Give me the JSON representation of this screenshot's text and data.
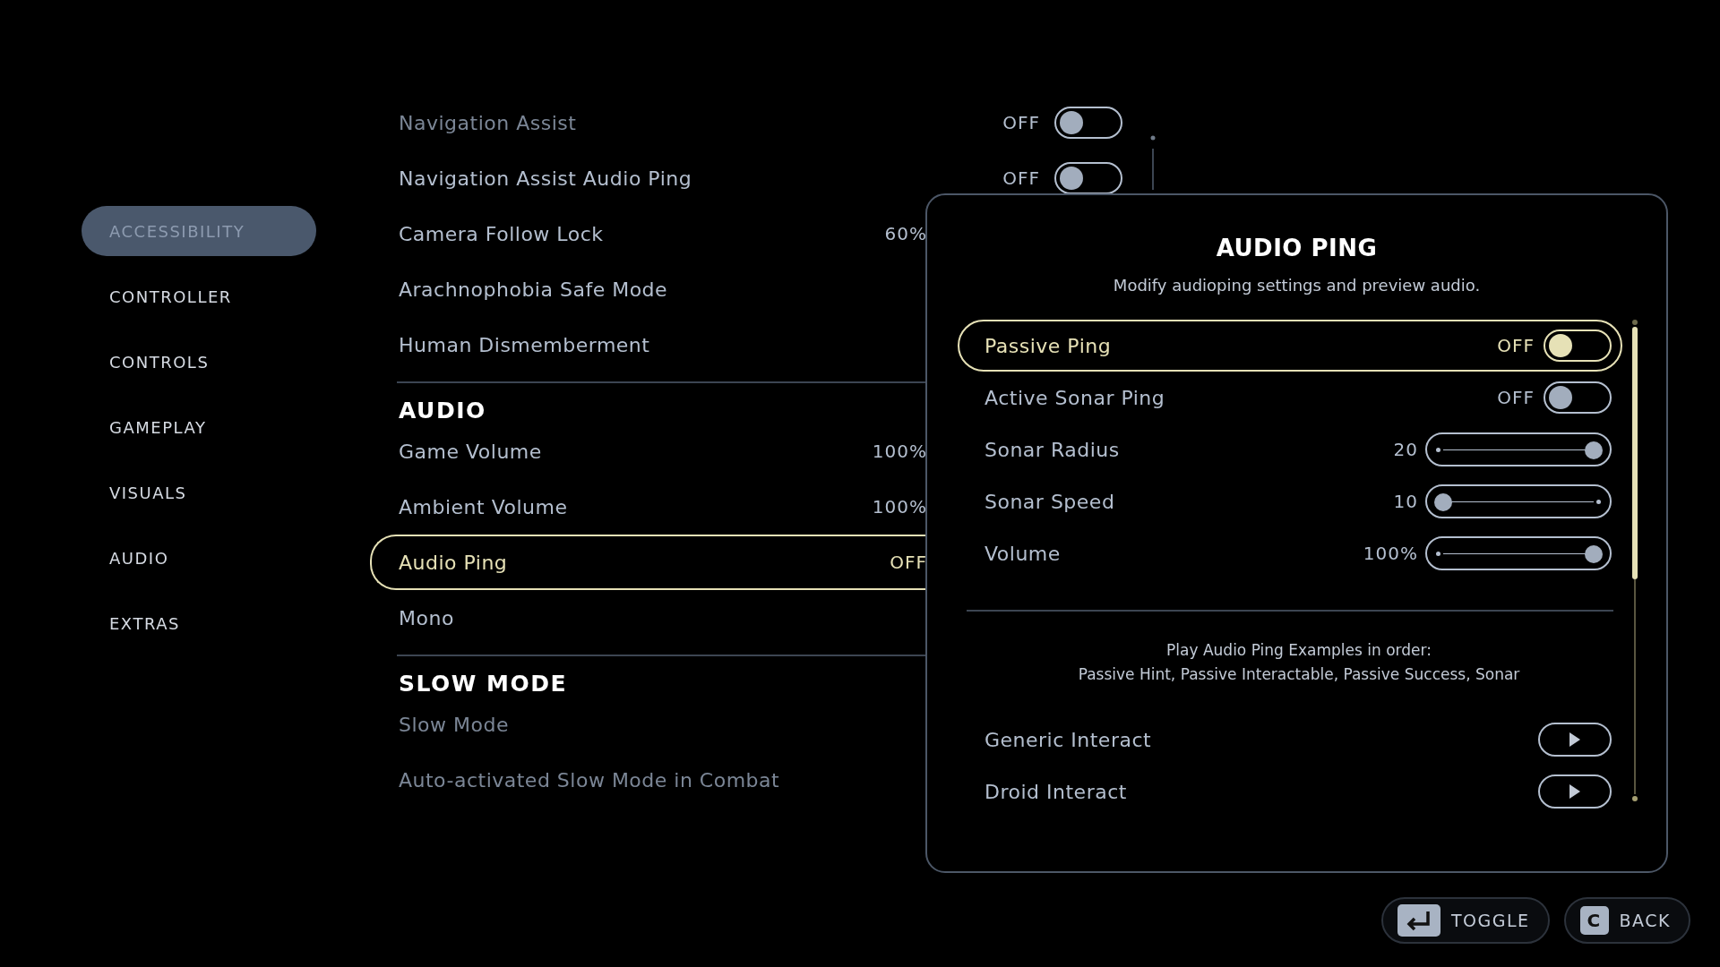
{
  "nav": [
    {
      "label": "ACCESSIBILITY",
      "selected": true
    },
    {
      "label": "CONTROLLER",
      "selected": false
    },
    {
      "label": "CONTROLS",
      "selected": false
    },
    {
      "label": "GAMEPLAY",
      "selected": false
    },
    {
      "label": "VISUALS",
      "selected": false
    },
    {
      "label": "AUDIO",
      "selected": false
    },
    {
      "label": "EXTRAS",
      "selected": false
    }
  ],
  "settings": [
    {
      "kind": "toggle",
      "label": "Navigation Assist",
      "value": "OFF",
      "on": false,
      "selected": false,
      "disabled": true
    },
    {
      "kind": "toggle",
      "label": "Navigation Assist Audio Ping",
      "value": "OFF",
      "on": false,
      "selected": false
    },
    {
      "kind": "value",
      "label": "Camera Follow Lock",
      "value": "60%",
      "selected": false
    },
    {
      "kind": "value",
      "label": "Arachnophobia Safe Mode",
      "selected": false
    },
    {
      "kind": "value",
      "label": "Human Dismemberment",
      "selected": false
    },
    {
      "kind": "divider"
    },
    {
      "kind": "heading",
      "label": "AUDIO"
    },
    {
      "kind": "value",
      "label": "Game Volume",
      "value": "100%",
      "selected": false
    },
    {
      "kind": "value",
      "label": "Ambient Volume",
      "value": "100%",
      "selected": false
    },
    {
      "kind": "value",
      "label": "Audio Ping",
      "value": "OFF",
      "selected": true
    },
    {
      "kind": "value",
      "label": "Mono",
      "selected": false
    },
    {
      "kind": "divider"
    },
    {
      "kind": "heading",
      "label": "SLOW MODE"
    },
    {
      "kind": "value",
      "label": "Slow Mode",
      "selected": false,
      "disabled": true
    },
    {
      "kind": "value",
      "label": "Auto-activated Slow Mode in Combat",
      "selected": false,
      "disabled": true
    }
  ],
  "panel": {
    "title": "AUDIO PING",
    "subtitle": "Modify audioping settings and preview audio.",
    "rows": [
      {
        "kind": "toggle",
        "label": "Passive Ping",
        "value": "OFF",
        "on": false,
        "selected": true
      },
      {
        "kind": "toggle",
        "label": "Active Sonar Ping",
        "value": "OFF",
        "on": false,
        "selected": false
      },
      {
        "kind": "slider",
        "label": "Sonar Radius",
        "value": "20",
        "level": 1,
        "selected": false
      },
      {
        "kind": "slider",
        "label": "Sonar Speed",
        "value": "10",
        "level": 0,
        "selected": false
      },
      {
        "kind": "slider",
        "label": "Volume",
        "value": "100%",
        "level": 1,
        "selected": false
      }
    ],
    "note": [
      "Play Audio Ping Examples in order:",
      "Passive Hint, Passive Interactable, Passive Success, Sonar"
    ],
    "previews": [
      {
        "label": "Generic Interact"
      },
      {
        "label": "Droid Interact"
      }
    ]
  },
  "footer": [
    {
      "kind": "enter-key",
      "label": "TOGGLE"
    },
    {
      "kind": "letter-key",
      "key": "C",
      "label": "BACK"
    }
  ]
}
